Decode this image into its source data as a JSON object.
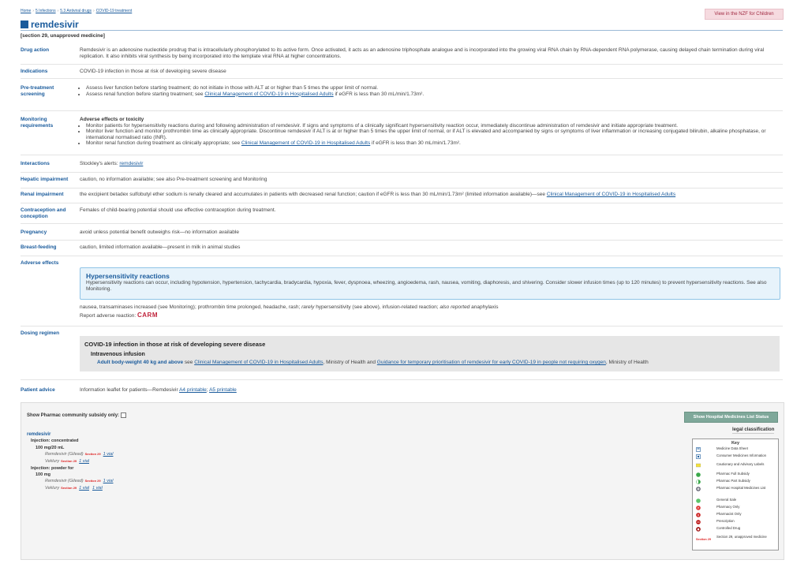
{
  "breadcrumbs": [
    "Home",
    "5 Infections",
    "5.3 Antiviral drugs",
    "COVID-19 treatment"
  ],
  "nzf_children_button": "View in the NZF for Children",
  "drug": {
    "title": "remdesivir",
    "subtitle": "[section 29, unapproved medicine]"
  },
  "sections": {
    "drug_action": {
      "label": "Drug action",
      "text": "Remdesivir is an adenosine nucleotide prodrug that is intracellularly phosphorylated to its active form. Once activated, it acts as an adenosine triphosphate analogue and is incorporated into the growing viral RNA chain by RNA-dependent RNA polymerase, causing delayed chain termination during viral replication. It also inhibits viral synthesis by being incorporated into the template viral RNA at higher concentrations."
    },
    "indications": {
      "label": "Indications",
      "text": "COVID-19 infection in those at risk of developing severe disease"
    },
    "pretreatment": {
      "label": "Pre-treatment screening",
      "item1": "Assess liver function before starting treatment; do not initiate in those with ALT at or higher than 5 times the upper limit of normal.",
      "item2_pre": "Assess renal function before starting treatment; see",
      "item2_link": "Clinical Management of COVID-19 in Hospitalised Adults",
      "item2_post": "if eGFR is less than 30 mL/min/1.73m²."
    },
    "monitoring": {
      "label": "Monitoring requirements",
      "heading": "Adverse effects or toxicity",
      "item1": "Monitor patients for hypersensitivity reactions during and following administration of remdesivir. If signs and symptoms of a clinically significant hypersensitivity reaction occur, immediately discontinue administration of remdesivir and initiate appropriate treatment.",
      "item2": "Monitor liver function and monitor prothrombin time as clinically appropriate. Discontinue remdesivir if ALT is at or higher than 5 times the upper limit of normal, or if ALT is elevated and accompanied by signs or symptoms of liver inflammation or increasing conjugated bilirubin, alkaline phosphatase, or international normalised ratio (INR).",
      "item3_pre": "Monitor renal function during treatment as clinically appropriate; see",
      "item3_link": "Clinical Management of COVID-19 in Hospitalised Adults",
      "item3_post": "if eGFR is less than 30 mL/min/1.73m²."
    },
    "interactions": {
      "label": "Interactions",
      "pre": "Stockley's alerts:",
      "link": "remdesivir"
    },
    "hepatic": {
      "label": "Hepatic impairment",
      "text": "caution, no information available; see also Pre-treatment screening and Monitoring"
    },
    "renal": {
      "label": "Renal impairment",
      "pre": "the excipient betadex sulfobutyl ether sodium is renally cleared and accumulates in patients with decreased renal function; caution if eGFR is less than 30 mL/min/1.73m² (limited information available)—see",
      "link": "Clinical Management of COVID-19 in Hospitalised Adults"
    },
    "contraception": {
      "label": "Contraception and conception",
      "text": "Females of child-bearing potential should use effective contraception during treatment."
    },
    "pregnancy": {
      "label": "Pregnancy",
      "text": "avoid unless potential benefit outweighs risk—no information available"
    },
    "breastfeeding": {
      "label": "Breast-feeding",
      "text": "caution, limited information available—present in milk in animal studies"
    },
    "adverse": {
      "label": "Adverse effects",
      "box_title": "Hypersensitivity reactions",
      "box_text": "Hypersensitivity reactions can occur, including hypotension, hypertension, tachycardia, bradycardia, hypoxia, fever, dyspnoea, wheezing, angioedema, rash, nausea, vomiting, diaphoresis, and shivering. Consider slower infusion times (up to 120 minutes) to prevent hypersensitivity reactions. See also Monitoring.",
      "line_pre": "nausea, transaminases increased (see Monitoring); prothrombin time prolonged, headache, rash;",
      "rarely": "rarely",
      "line_mid": "hypersensitivity (see above), infusion-related reaction;",
      "also": "also reported",
      "line_end": "anaphylaxis",
      "report": "Report adverse reaction:",
      "carm": "CARM"
    },
    "dosing": {
      "label": "Dosing regimen",
      "title": "COVID-19 infection in those at risk of developing severe disease",
      "route": "Intravenous infusion",
      "who": "Adult body-weight 40 kg and above",
      "see": "see",
      "link1": "Clinical Management of COVID-19 in Hospitalised Adults",
      "mid": ", Ministry of Health and",
      "link2": "Guidance for temporary prioritisation of remdesivir for early COVID-19 in people not requiring oxygen",
      "end": ", Ministry of Health"
    },
    "patient_advice": {
      "label": "Patient advice",
      "pre": "Information leaflet for patients—Remdesivir",
      "link1": "A4 printable",
      "link2": "A5 printable"
    }
  },
  "subsidy": {
    "checkbox_label": "Show Pharmac community subsidy only:",
    "hospital_button": "Show Hospital Medicines List Status",
    "legal_label": "legal classification",
    "medicine": "remdesivir",
    "forms": [
      {
        "form": "Injection: concentrated",
        "strength": "100 mg/20 mL",
        "products": [
          {
            "name": "Remdesivir (Gilead)",
            "section": "Section 29",
            "pack": "1 vial"
          },
          {
            "name": "Veklury",
            "section": "Section 29",
            "pack": "1 vial"
          }
        ]
      },
      {
        "form": "Injection: powder for",
        "strength": "100 mg",
        "products": [
          {
            "name": "Remdesivir (Gilead)",
            "section": "Section 29",
            "pack": "1 vial"
          },
          {
            "name": "Veklury",
            "section": "Section 29",
            "pack": "1 vial",
            "pack2": "1 vial"
          }
        ]
      }
    ],
    "key": {
      "title": "Key",
      "items": [
        "Medicine Data Sheet",
        "Consumer Medicines Information",
        "Cautionary and Advisory Labels",
        "Pharmac Full Subsidy",
        "Pharmac Part Subsidy",
        "Pharmac Hospital Medicines List",
        "General Sale",
        "Pharmacy Only",
        "Pharmacist Only",
        "Prescription",
        "Controlled Drug",
        "Section 29, unapproved medicine"
      ],
      "section_badge": "Section 29"
    }
  }
}
